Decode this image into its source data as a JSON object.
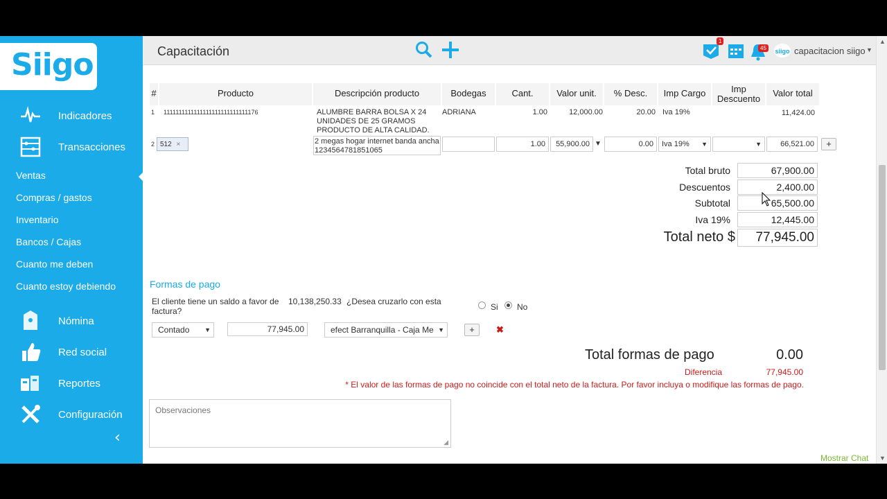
{
  "sidebar": {
    "logo": "Siigo",
    "main_items": [
      {
        "label": "Indicadores",
        "icon": "pulse-icon"
      },
      {
        "label": "Transacciones",
        "icon": "abacus-icon"
      }
    ],
    "sub_items": [
      "Ventas",
      "Compras / gastos",
      "Inventario",
      "Bancos / Cajas",
      "Cuanto me deben",
      "Cuanto estoy debiendo"
    ],
    "lower_items": [
      {
        "label": "Nómina",
        "icon": "document-icon"
      },
      {
        "label": "Red social",
        "icon": "thumbs-up-icon"
      },
      {
        "label": "Reportes",
        "icon": "reports-icon"
      },
      {
        "label": "Configuración",
        "icon": "tools-icon"
      }
    ]
  },
  "header": {
    "title": "Capacitación",
    "badge_tasks": "1",
    "badge_notifications": "45",
    "user_logo": "siigo",
    "user_name": "capacitacion siigo"
  },
  "table": {
    "headers": [
      "#",
      "Producto",
      "Descripción producto",
      "Bodegas",
      "Cant.",
      "Valor unit.",
      "% Desc.",
      "Imp Cargo",
      "Imp Descuento",
      "Valor total"
    ],
    "row1": {
      "num": "1",
      "product": "1111111111111111111111111111176",
      "description": "ALUMBRE BARRA BOLSA X 24 UNIDADES DE 25 GRAMOS PRODUCTO DE ALTA CALIDAD.",
      "warehouse": "ADRIANA",
      "qty": "1.00",
      "unit_value": "12,000.00",
      "discount": "20.00",
      "imp_cargo": "Iva 19%",
      "total": "11,424.00"
    },
    "row2": {
      "num": "2",
      "product_tag": "512",
      "description": "2 megas hogar internet banda ancha 1234564781851065",
      "qty": "1.00",
      "unit_value": "55,900.00",
      "discount": "0.00",
      "imp_cargo": "Iva 19%",
      "total": "66,521.00",
      "add_label": "+"
    }
  },
  "totals": {
    "bruto_label": "Total bruto",
    "bruto": "67,900.00",
    "desc_label": "Descuentos",
    "desc": "2,400.00",
    "subtotal_label": "Subtotal",
    "subtotal": "65,500.00",
    "iva_label": "Iva 19%",
    "iva": "12,445.00",
    "neto_label": "Total neto $",
    "neto": "77,945.00"
  },
  "payments": {
    "title": "Formas de pago",
    "balance_text_1": "El cliente tiene un saldo a favor de",
    "balance_amount": "10,138,250.33",
    "balance_text_2": "¿Desea cruzarlo con esta",
    "balance_text_3": "factura?",
    "radio_yes": "Si",
    "radio_no": "No",
    "method": "Contado",
    "amount": "77,945.00",
    "account": "efect Barranquilla - Caja Me",
    "add_label": "+",
    "remove_label": "✖",
    "total_label": "Total formas de pago",
    "total_value": "0.00",
    "diff_label": "Diferencia",
    "diff_value": "77,945.00",
    "warning": "* El valor de las formas de pago no coincide con el total neto de la factura. Por favor incluya o modifique las formas de pago."
  },
  "observations_placeholder": "Observaciones",
  "chat_label": "Mostrar Chat",
  "colors": {
    "brand": "#1aabe8",
    "error": "#cc1a1a",
    "chat": "#78b832"
  }
}
